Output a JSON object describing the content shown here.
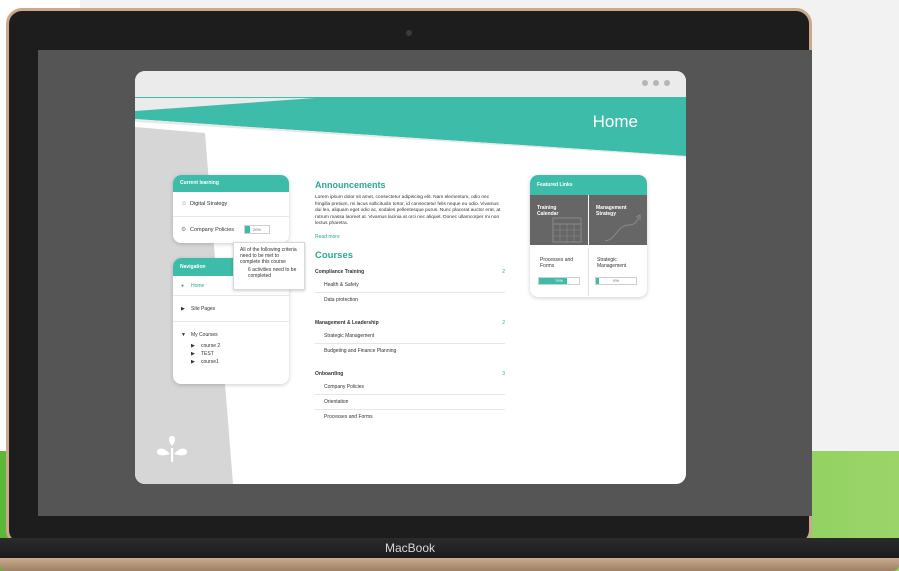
{
  "device": {
    "label": "MacBook"
  },
  "window": {
    "title": "Home"
  },
  "current_learning": {
    "header": "Current learning",
    "items": [
      {
        "label": "Digital Strategy",
        "icon": "people-icon"
      },
      {
        "label": "Company Policies",
        "icon": "policy-icon",
        "progress": 0.2,
        "progress_label": "20%"
      }
    ]
  },
  "tooltip": {
    "line1": "All of the following criteria need to be met to complete this course",
    "line2": "6 activities need to be completed"
  },
  "navigation": {
    "header": "Navigation",
    "items": [
      {
        "label": "Home"
      },
      {
        "label": "Site Pages"
      },
      {
        "label": "My Courses",
        "children": [
          "course 2",
          "TEST",
          "course1"
        ]
      }
    ]
  },
  "announcements": {
    "title": "Announcements",
    "body": "Lorem ipsum dolor sit amet, consectetur adipiscing elit. Nam elementum, odio nec fringilla pretium, mi lacus sollicitudin tortor, id consectetur felis neque eu odio. Vivamus dui leo, aliquam eget odio ac, sodales pellentesque purus. Nunc placerat auctor erat, at rutrum massa laoreet at. Vivamus lacinia at orci nec aliquet. Donec ullamcorper mi non lectus pharetra.",
    "read_more": "Read more"
  },
  "courses": {
    "title": "Courses",
    "groups": [
      {
        "name": "Compliance Training",
        "count": "2",
        "items": [
          "Health & Safety",
          "Data protection"
        ]
      },
      {
        "name": "Management & Leadership",
        "count": "2",
        "items": [
          "Strategic Management",
          "Budgeting and Finance Planning"
        ]
      },
      {
        "name": "Onboarding",
        "count": "3",
        "items": [
          "Company Policies",
          "Orientation",
          "Processes and Forms"
        ]
      }
    ]
  },
  "featured": {
    "header": "Featured Links",
    "tiles": [
      {
        "label": "Training Calendar",
        "icon": "calendar-icon"
      },
      {
        "label": "Management Strategy",
        "icon": "strategy-arrow-icon"
      }
    ],
    "progress_items": [
      {
        "label": "Processes and Forms",
        "progress": 0.7,
        "progress_label": "70%"
      },
      {
        "label": "Strategic Management",
        "progress": 0.0,
        "progress_label": "0%"
      }
    ]
  },
  "colors": {
    "accent": "#3dbcaa",
    "accent_text": "#2aa997",
    "panel_gray": "#d6d6d6",
    "tile_gray": "#666666"
  },
  "logo": {
    "icon": "sprout-icon"
  }
}
